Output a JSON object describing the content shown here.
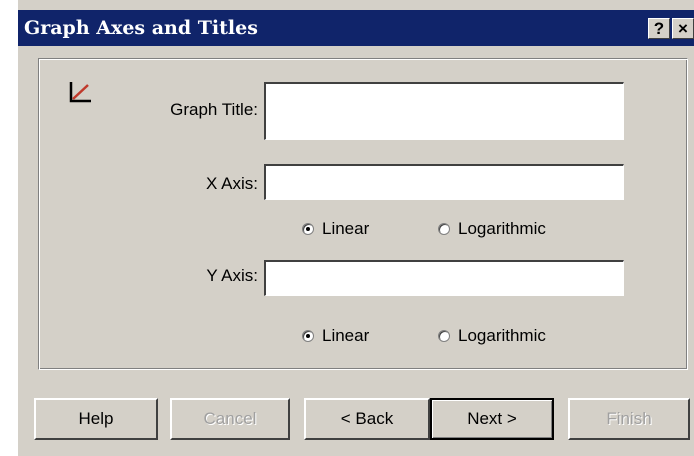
{
  "window": {
    "title": "Graph Axes and Titles",
    "help_glyph": "?",
    "close_glyph": "×"
  },
  "form": {
    "graph_title_label": "Graph Title:",
    "graph_title_value": "",
    "x_axis_label": "X Axis:",
    "x_axis_value": "",
    "x_scale": {
      "linear": "Linear",
      "logarithmic": "Logarithmic",
      "selected": "Linear"
    },
    "y_axis_label": "Y Axis:",
    "y_axis_value": "",
    "y_scale": {
      "linear": "Linear",
      "logarithmic": "Logarithmic",
      "selected": "Linear"
    }
  },
  "buttons": {
    "help": "Help",
    "cancel": "Cancel",
    "back": "< Back",
    "next": "Next >",
    "finish": "Finish"
  },
  "colors": {
    "titlebar": "#10246a",
    "face": "#d4d0c8",
    "icon_accent": "#c0392b"
  },
  "icons": {
    "wizard_icon": "graph-axes-icon"
  }
}
